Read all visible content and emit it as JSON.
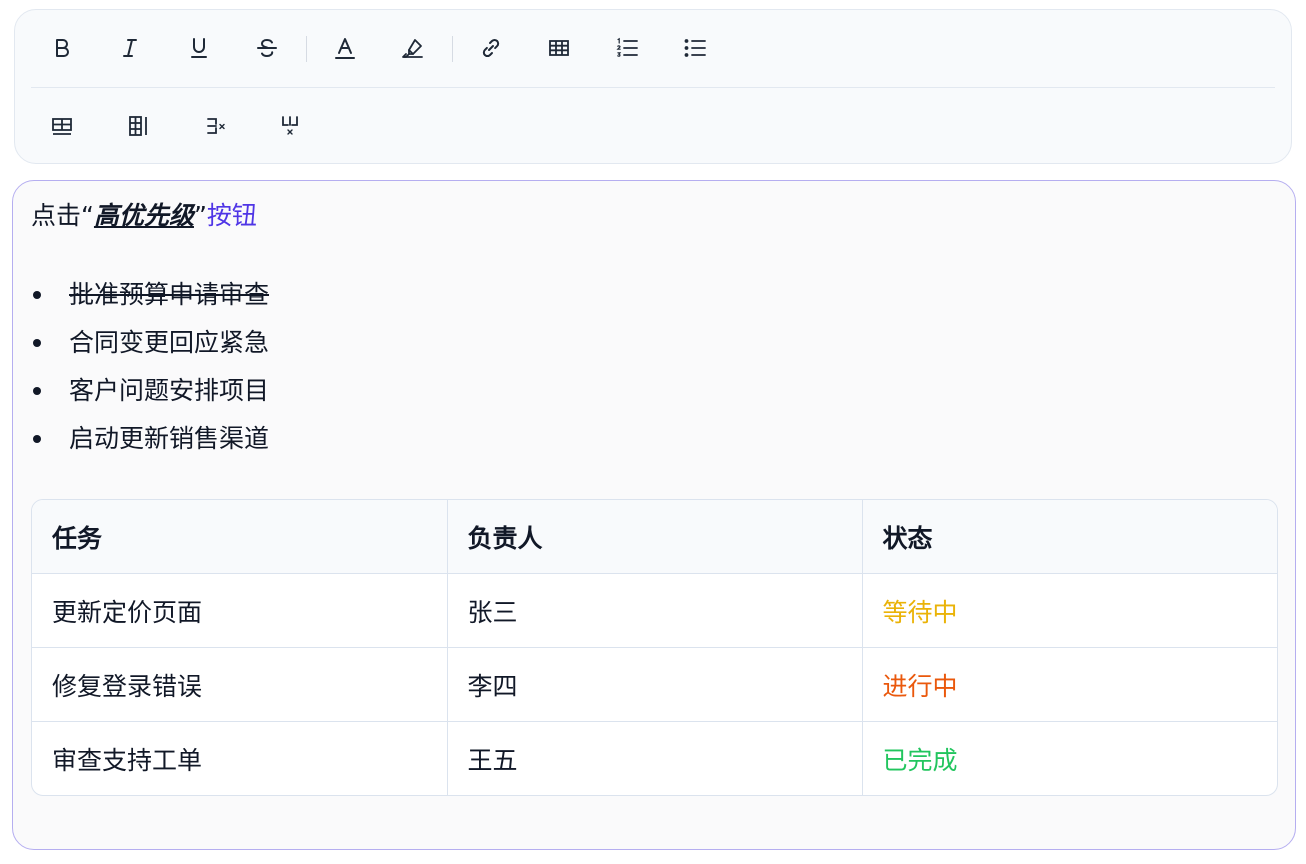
{
  "toolbar": {
    "row1": [
      {
        "name": "bold-button",
        "icon": "bold-icon"
      },
      {
        "name": "italic-button",
        "icon": "italic-icon"
      },
      {
        "name": "underline-button",
        "icon": "underline-icon"
      },
      {
        "name": "strikethrough-button",
        "icon": "strikethrough-icon"
      },
      {
        "name": "text-color-button",
        "icon": "text-color-icon"
      },
      {
        "name": "highlight-button",
        "icon": "highlighter-icon"
      },
      {
        "name": "link-button",
        "icon": "link-icon"
      },
      {
        "name": "insert-table-button",
        "icon": "table-icon"
      },
      {
        "name": "ordered-list-button",
        "icon": "ordered-list-icon"
      },
      {
        "name": "bullet-list-button",
        "icon": "bullet-list-icon"
      }
    ],
    "row2": [
      {
        "name": "add-row-button",
        "icon": "add-row-icon"
      },
      {
        "name": "add-column-button",
        "icon": "add-column-icon"
      },
      {
        "name": "delete-row-button",
        "icon": "delete-row-icon"
      },
      {
        "name": "delete-column-button",
        "icon": "delete-column-icon"
      }
    ]
  },
  "content": {
    "paragraph": {
      "prefix": "点击“",
      "emphasis": "高优先级",
      "quote_close": "”",
      "link": "按钮"
    },
    "list": [
      {
        "text": "批准预算申请审查",
        "strikethrough": true
      },
      {
        "text": "合同变更回应紧急",
        "strikethrough": false
      },
      {
        "text": "客户问题安排项目",
        "strikethrough": false
      },
      {
        "text": "启动更新销售渠道",
        "strikethrough": false
      }
    ],
    "table": {
      "headers": [
        "任务",
        "负责人",
        "状态"
      ],
      "rows": [
        {
          "task": "更新定价页面",
          "owner": "张三",
          "status": "等待中",
          "status_color": "#eab308"
        },
        {
          "task": "修复登录错误",
          "owner": "李四",
          "status": "进行中",
          "status_color": "#ea580c"
        },
        {
          "task": "审查支持工单",
          "owner": "王五",
          "status": "已完成",
          "status_color": "#22c55e"
        }
      ]
    }
  },
  "colors": {
    "link": "#4f35e6",
    "editor_border": "#b5aef0",
    "toolbar_bg": "#f8fafc"
  }
}
